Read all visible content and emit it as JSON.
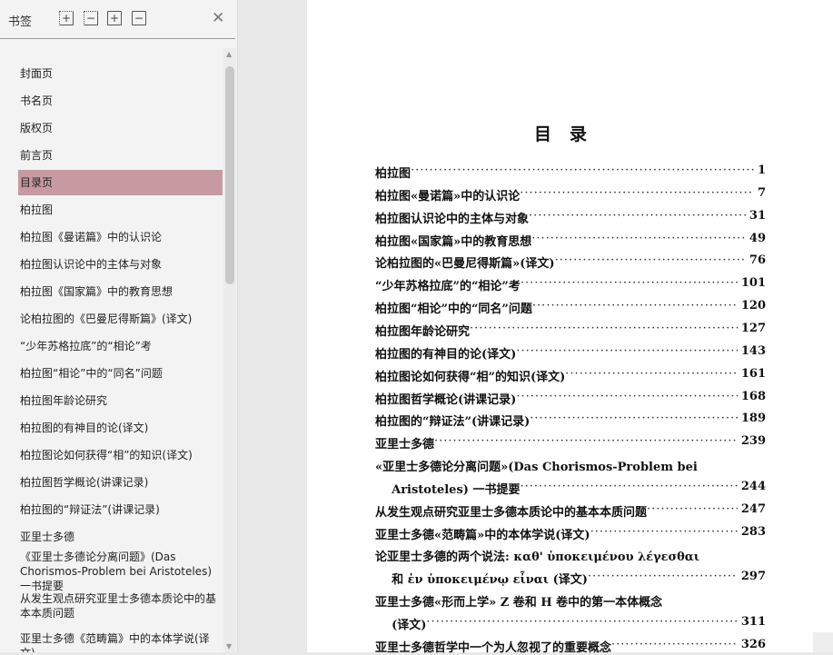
{
  "sidebar": {
    "title": "书签",
    "items": [
      "封面页",
      "书名页",
      "版权页",
      "前言页",
      "目录页",
      "柏拉图",
      "柏拉图《曼诺篇》中的认识论",
      "柏拉图认识论中的主体与对象",
      "柏拉图《国家篇》中的教育思想",
      "论柏拉图的《巴曼尼得斯篇》(译文)",
      "“少年苏格拉底”的“相论”考",
      "柏拉图“相论”中的“同名”问题",
      "柏拉图年龄论研究",
      "柏拉图的有神目的论(译文)",
      "柏拉图论如何获得“相”的知识(译文)",
      "柏拉图哲学概论(讲课记录)",
      "柏拉图的“辩证法”(讲课记录)",
      "亚里士多德",
      "《亚里士多德论分离问题》(Das Chorismos-Problem bei Aristoteles)一书提要",
      "从发生观点研究亚里士多德本质论中的基本本质问题",
      "亚里士多德《范畴篇》中的本体学说(译文)"
    ],
    "selected_index": 4
  },
  "toc": {
    "title": "目录",
    "rows": [
      {
        "label": "柏拉图",
        "page": "1"
      },
      {
        "label": "柏拉图«曼诺篇»中的认识论",
        "page": "7"
      },
      {
        "label": "柏拉图认识论中的主体与对象",
        "page": "31"
      },
      {
        "label": "柏拉图«国家篇»中的教育思想",
        "page": "49"
      },
      {
        "label": "论柏拉图的«巴曼尼得斯篇»(译文)",
        "page": "76"
      },
      {
        "label": "“少年苏格拉底”的“相论”考",
        "page": "101"
      },
      {
        "label": "柏拉图“相论”中的“同名”问题",
        "page": "120"
      },
      {
        "label": "柏拉图年龄论研究",
        "page": "127"
      },
      {
        "label": "柏拉图的有神目的论(译文)",
        "page": "143"
      },
      {
        "label": "柏拉图论如何获得“相”的知识(译文)",
        "page": "161"
      },
      {
        "label": "柏拉图哲学概论(讲课记录)",
        "page": "168"
      },
      {
        "label": "柏拉图的“辩证法”(讲课记录)",
        "page": "189"
      },
      {
        "label": "亚里士多德",
        "page": "239"
      },
      {
        "label": "«亚里士多德论分离问题»(Das Chorismos-Problem bei",
        "page": ""
      },
      {
        "label": "    Aristoteles) 一书提要",
        "page": "244"
      },
      {
        "label": "从发生观点研究亚里士多德本质论中的基本本质问题",
        "page": "247"
      },
      {
        "label": "亚里士多德«范畴篇»中的本体学说(译文)",
        "page": "283"
      },
      {
        "label": "论亚里士多德的两个说法: καθ' ὑποκειμένου λέγεσθαι",
        "page": ""
      },
      {
        "label": "    和 ἐν ὑποκειμένῳ εἶναι (译文)",
        "page": "297"
      },
      {
        "label": "亚里士多德«形而上学» Z 卷和 H 卷中的第一本体概念",
        "page": ""
      },
      {
        "label": "    (译文)",
        "page": "311"
      },
      {
        "label": "亚里士多德哲学中一个为人忽视了的重要概念",
        "page": "326"
      }
    ]
  }
}
